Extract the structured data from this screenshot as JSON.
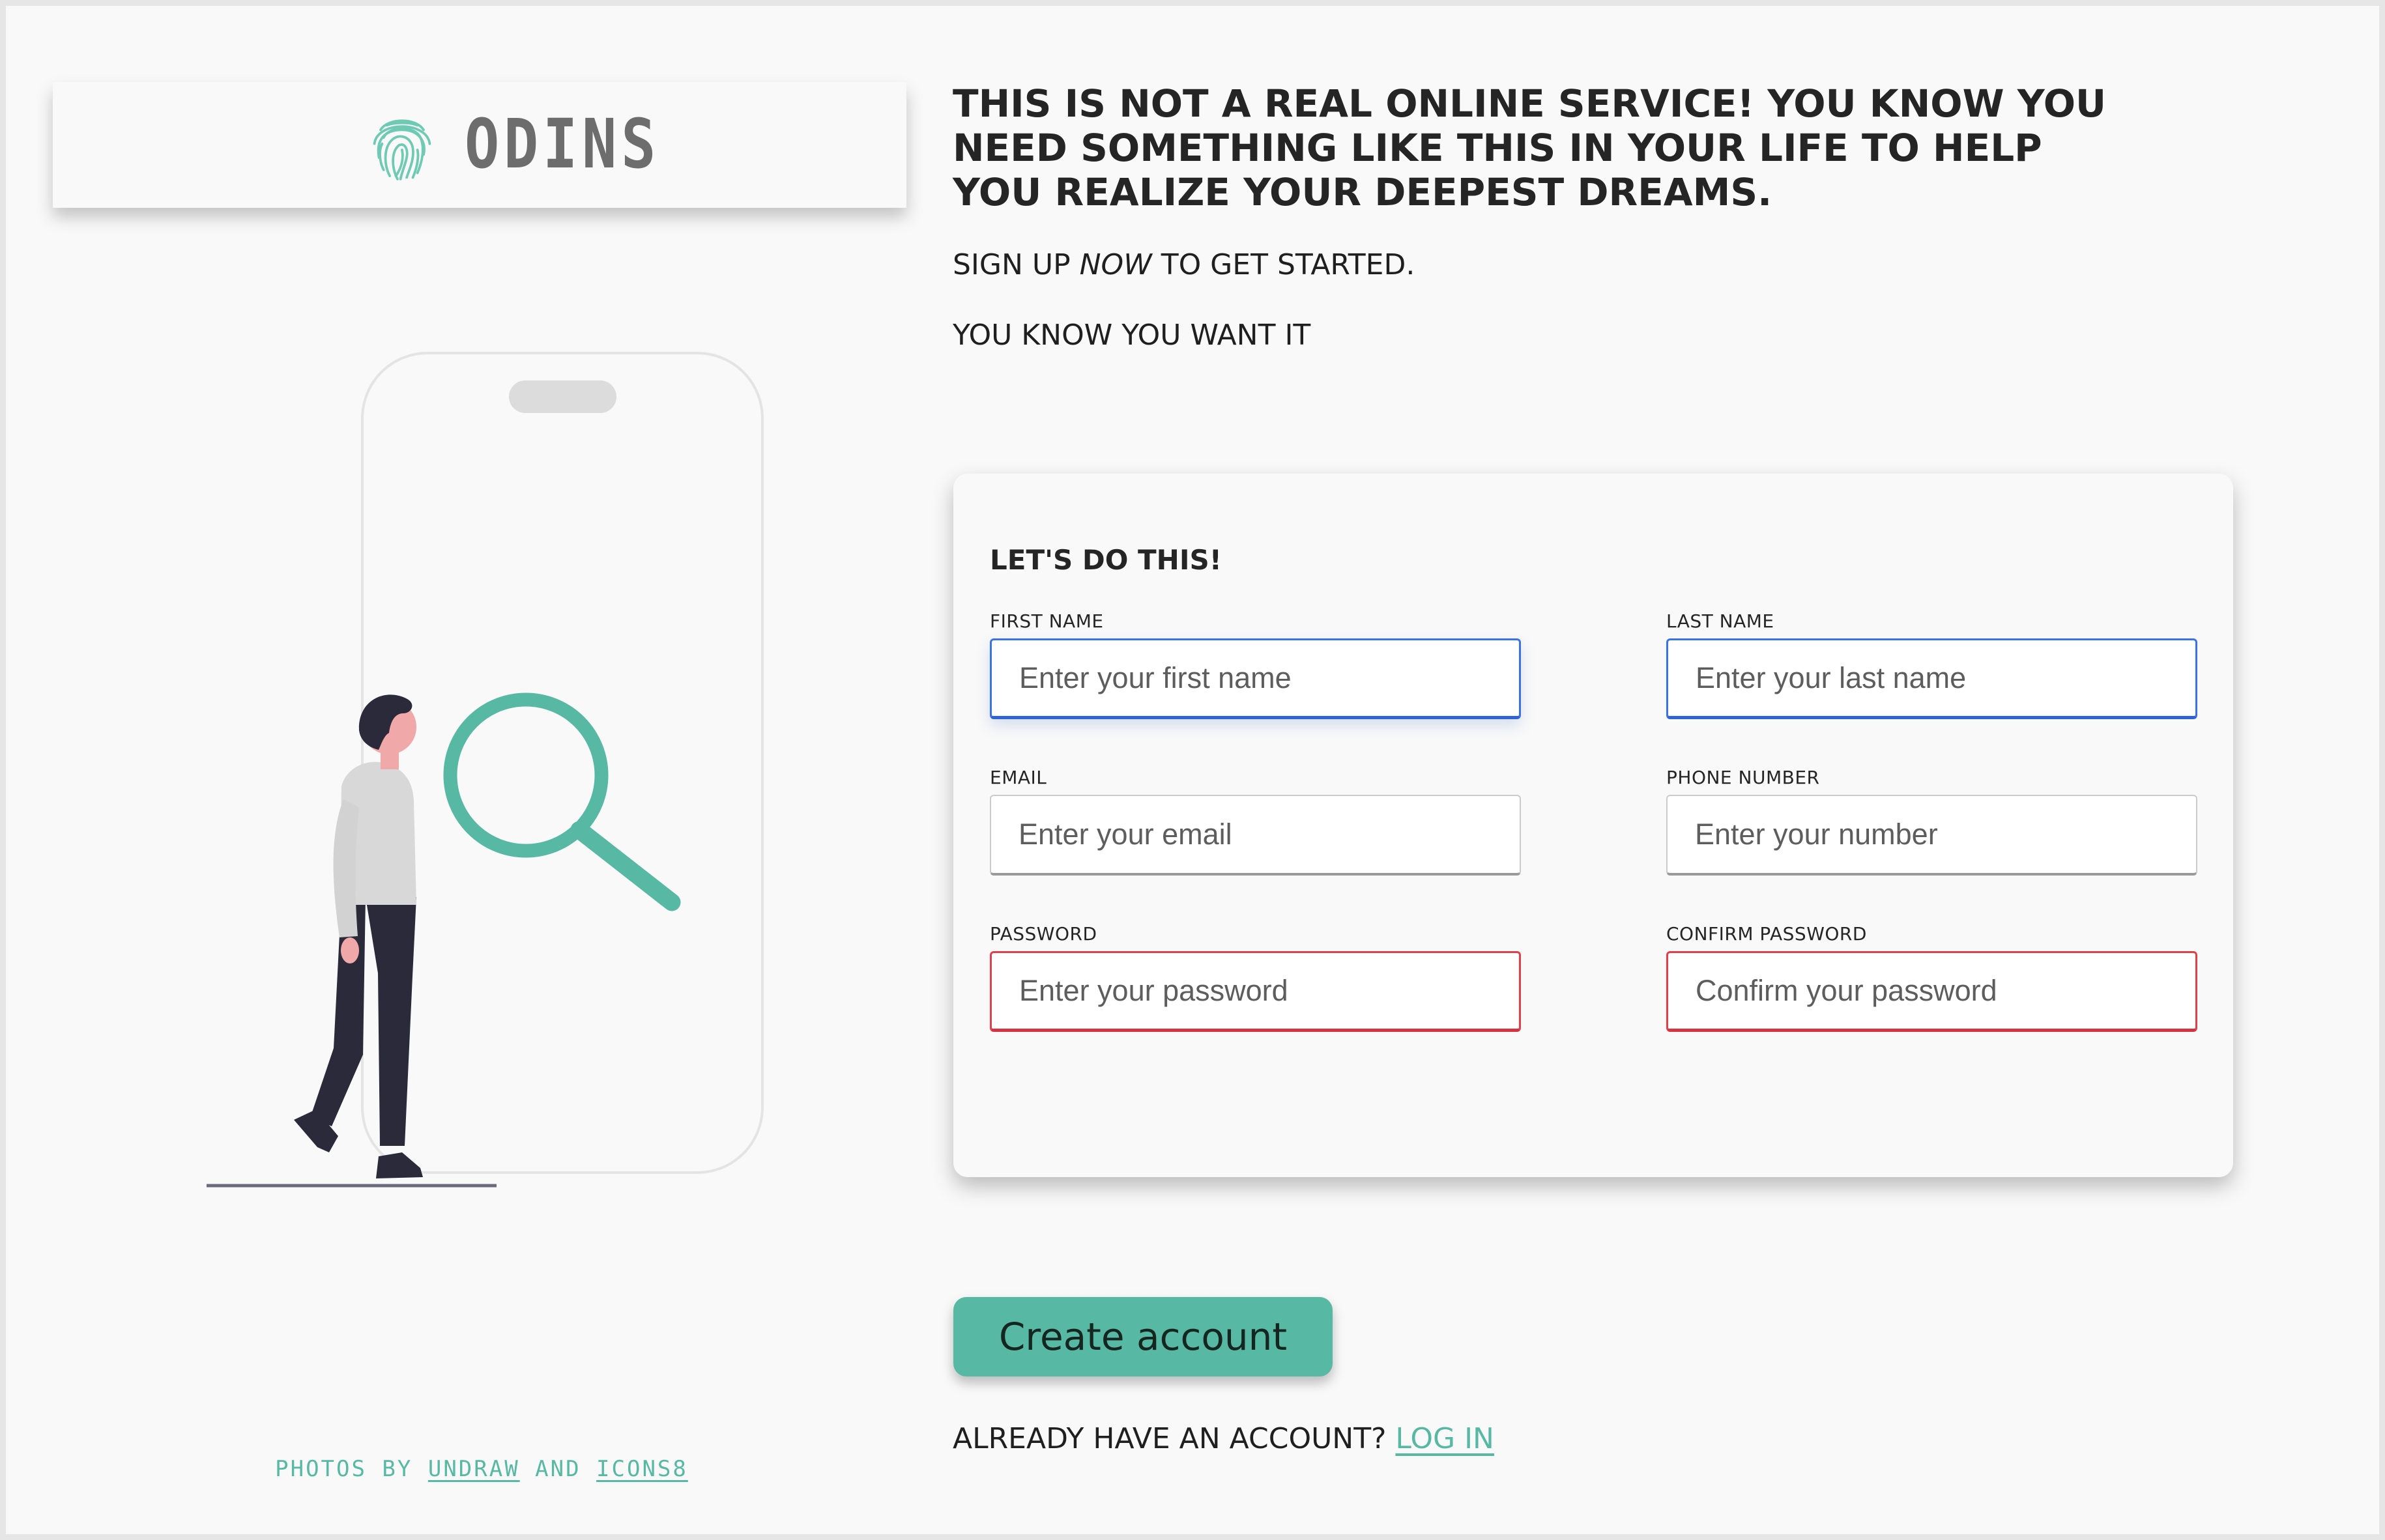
{
  "brand": {
    "name": "ODINS",
    "accent": "#57b9a3"
  },
  "hero": {
    "headline": "THIS IS NOT A REAL ONLINE SERVICE! YOU KNOW YOU NEED SOMETHING LIKE THIS IN YOUR LIFE TO HELP YOU REALIZE YOUR DEEPEST DREAMS.",
    "cta_before": "SIGN UP ",
    "cta_emph": "NOW",
    "cta_after": " TO GET STARTED.",
    "tagline": "YOU KNOW YOU WANT IT"
  },
  "form": {
    "title": "LET'S DO THIS!",
    "first_name": {
      "label": "FIRST NAME",
      "placeholder": "Enter your first name",
      "value": ""
    },
    "last_name": {
      "label": "LAST NAME",
      "placeholder": "Enter your last name",
      "value": ""
    },
    "email": {
      "label": "EMAIL",
      "placeholder": "Enter your email",
      "value": ""
    },
    "phone": {
      "label": "PHONE NUMBER",
      "placeholder": "Enter your number",
      "value": ""
    },
    "password": {
      "label": "PASSWORD",
      "placeholder": "Enter your password",
      "value": ""
    },
    "confirm_password": {
      "label": "CONFIRM PASSWORD",
      "placeholder": "Confirm your password",
      "value": ""
    },
    "state_colors": {
      "valid_border": "#3a73e6",
      "invalid_border": "#e0404b"
    }
  },
  "actions": {
    "create_label": "Create account",
    "login_prompt": "ALREADY HAVE AN ACCOUNT? ",
    "login_link": "LOG IN"
  },
  "credits": {
    "prefix": "PHOTOS BY ",
    "link1": "UNDRAW",
    "middle": " AND ",
    "link2": "ICONS8"
  },
  "icons": {
    "logo": "fingerprint-icon",
    "illustration": "person-with-magnifier-illustration"
  }
}
